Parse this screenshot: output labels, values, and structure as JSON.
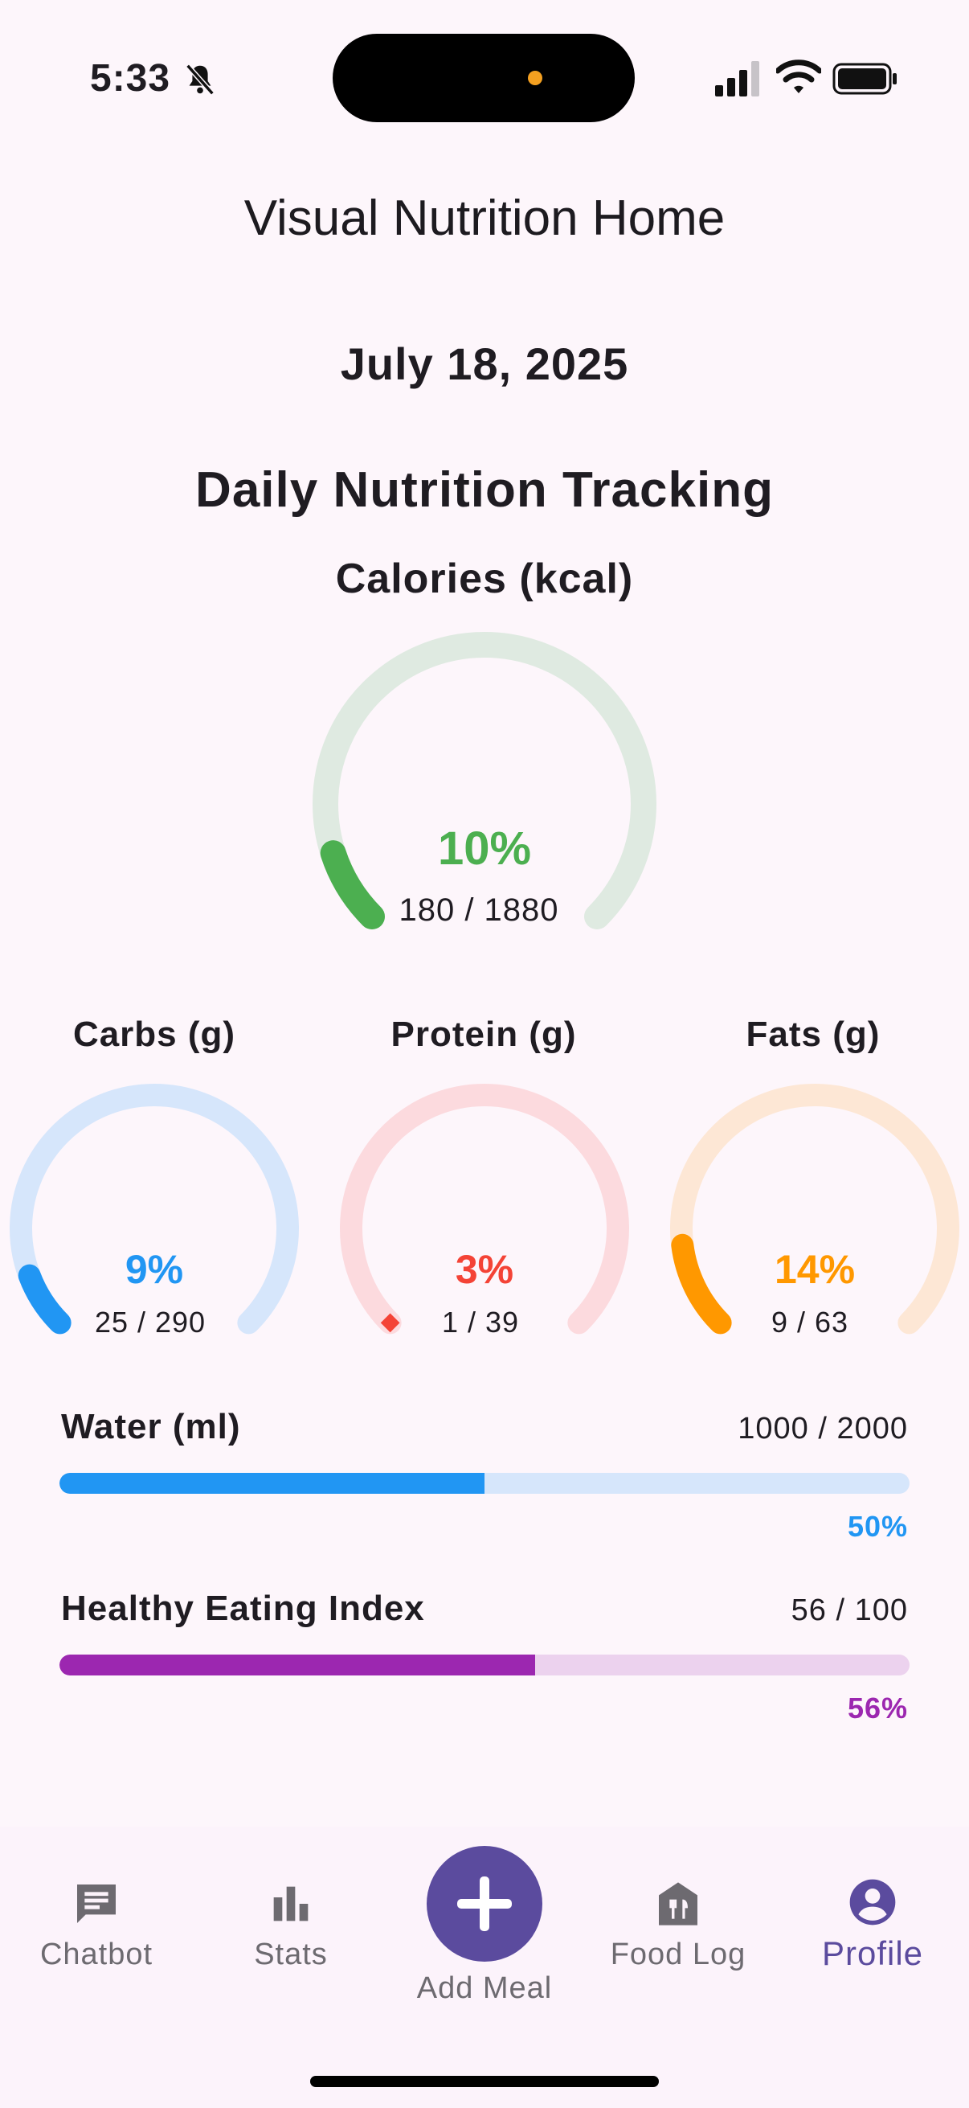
{
  "status_bar": {
    "time": "5:33",
    "icons": [
      "bell-slash-icon",
      "signal-icon",
      "wifi-icon",
      "battery-icon"
    ]
  },
  "app_title": "Visual Nutrition Home",
  "date": "July 18, 2025",
  "section_title": "Daily Nutrition Tracking",
  "calories": {
    "title": "Calories (kcal)",
    "percent_label": "10%",
    "value_label": "180 / 1880",
    "fraction": 0.1,
    "color": "#4caf50",
    "track_color": "#dfeae1"
  },
  "macros": [
    {
      "title": "Carbs (g)",
      "percent_label": "9%",
      "value_label": "25 / 290",
      "fraction": 0.09,
      "color": "#2196f3",
      "track_color": "#d6e6fb",
      "end_cap": "round"
    },
    {
      "title": "Protein (g)",
      "percent_label": "3%",
      "value_label": "1 / 39",
      "fraction": 0.03,
      "color": "#f44336",
      "track_color": "#fcdade",
      "end_cap": "diamond"
    },
    {
      "title": "Fats (g)",
      "percent_label": "14%",
      "value_label": "9 / 63",
      "fraction": 0.14,
      "color": "#ff9800",
      "track_color": "#fde7d5",
      "end_cap": "round"
    }
  ],
  "water": {
    "label": "Water (ml)",
    "value_label": "1000 / 2000",
    "percent_label": "50%",
    "fraction": 0.5,
    "color": "#2196f3",
    "track_color": "#d6e6fb"
  },
  "hei": {
    "label": "Healthy Eating Index",
    "value_label": "56 / 100",
    "percent_label": "56%",
    "fraction": 0.56,
    "color": "#9c27b0",
    "track_color": "#ecd2ee"
  },
  "bottom_nav": {
    "items": [
      {
        "label": "Chatbot",
        "icon": "chat-icon"
      },
      {
        "label": "Stats",
        "icon": "bar-chart-icon"
      },
      {
        "label": "Add Meal",
        "icon": "plus-icon"
      },
      {
        "label": "Food Log",
        "icon": "food-log-icon"
      },
      {
        "label": "Profile",
        "icon": "profile-icon",
        "active": true
      }
    ],
    "active_color": "#5b4b9e",
    "inactive_color": "#6d6a70"
  }
}
